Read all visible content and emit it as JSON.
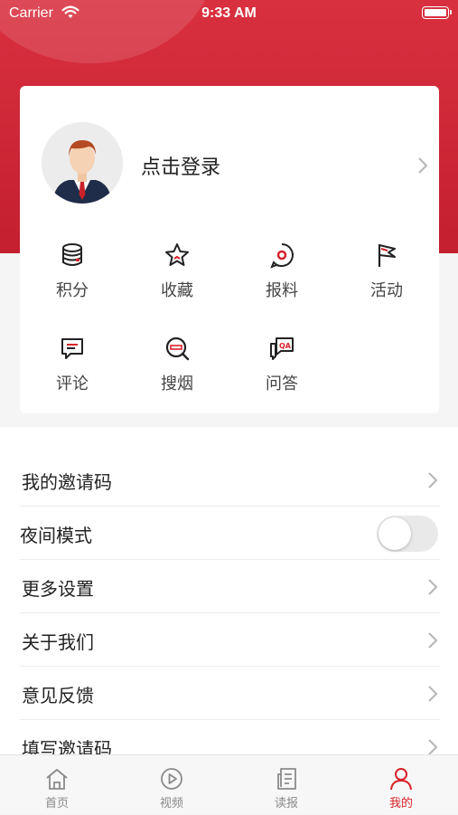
{
  "status_bar": {
    "carrier": "Carrier",
    "time": "9:33 AM"
  },
  "profile": {
    "login_label": "点击登录"
  },
  "features": [
    {
      "label": "积分",
      "icon": "coins-icon"
    },
    {
      "label": "收藏",
      "icon": "star-icon"
    },
    {
      "label": "报料",
      "icon": "report-icon"
    },
    {
      "label": "活动",
      "icon": "flag-icon"
    },
    {
      "label": "评论",
      "icon": "comment-icon"
    },
    {
      "label": "搜烟",
      "icon": "search-cigarette-icon"
    },
    {
      "label": "问答",
      "icon": "qa-icon"
    }
  ],
  "settings": [
    {
      "label": "我的邀请码"
    },
    {
      "label": "夜间模式",
      "toggle": false
    },
    {
      "label": "更多设置"
    },
    {
      "label": "关于我们"
    },
    {
      "label": "意见反馈"
    },
    {
      "label": "填写邀请码"
    }
  ],
  "tabbar": {
    "items": [
      {
        "label": "首页",
        "icon": "home-icon"
      },
      {
        "label": "视频",
        "icon": "play-icon"
      },
      {
        "label": "读报",
        "icon": "newspaper-icon"
      },
      {
        "label": "我的",
        "icon": "user-icon",
        "active": true
      }
    ]
  },
  "colors": {
    "brand": "#d8232a",
    "hero": "#d9303f"
  }
}
